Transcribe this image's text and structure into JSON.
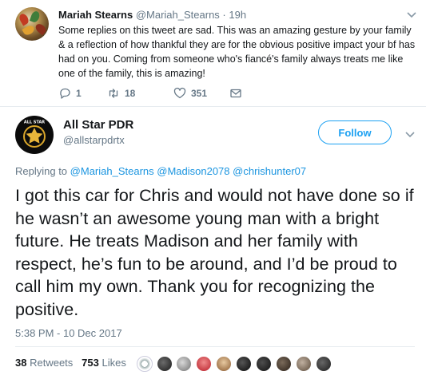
{
  "reply_tweet": {
    "name": "Mariah Stearns",
    "handle": "@Mariah_Stearns",
    "separator": "·",
    "time": "19h",
    "text": "Some replies on this tweet are sad. This was an amazing gesture by your family & a reflection of how thankful they are for the obvious positive impact your bf has had on you. Coming from someone who's fiancé's family always treats me like one of the family, this is amazing!",
    "actions": {
      "reply_count": "1",
      "retweet_count": "18",
      "like_count": "351"
    }
  },
  "main_tweet": {
    "avatar_text": "ALL STAR",
    "name": "All Star PDR",
    "handle": "@allstarpdrtx",
    "follow_label": "Follow",
    "replying_prefix": "Replying to",
    "replying_to": [
      "@Mariah_Stearns",
      "@Madison2078",
      "@chrishunter07"
    ],
    "text": "I got this car for Chris and would not have done so if he wasn’t an awesome young man with a bright future. He treats Madison and her family with respect, he’s fun to be around, and I’d be proud to call him my own. Thank you for recognizing the positive.",
    "timestamp": "5:38 PM - 10 Dec 2017",
    "retweets_count": "38",
    "retweets_label": "Retweets",
    "likes_count": "753",
    "likes_label": "Likes"
  },
  "colors": {
    "accent": "#1da1f2",
    "link": "#1b95e0",
    "muted": "#657786",
    "text": "#14171a"
  }
}
